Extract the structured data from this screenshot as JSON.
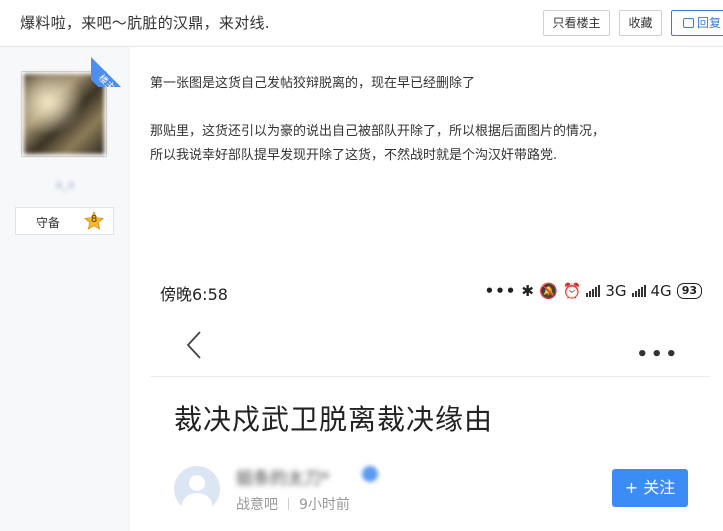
{
  "header": {
    "title": "爆料啦，来吧～肮脏的汉鼎，来对线.",
    "only_louzhu": "只看楼主",
    "favorite": "收藏",
    "reply": "回复"
  },
  "author": {
    "username": "a_a",
    "badge": "楼主",
    "rank_name": "守备",
    "rank_level": "8"
  },
  "post": {
    "lines": [
      "第一张图是这货自己发帖狡辩脱离的，现在早已经删除了",
      "",
      "那贴里，这货还引以为豪的说出自己被部队开除了，所以根据后面图片的情况，",
      "所以我说幸好部队提早发现开除了这货，不然战时就是个沟汉奸带路党."
    ]
  },
  "embedded": {
    "time": "傍晚6:58",
    "network1": "3G",
    "network2": "4G",
    "battery": "93",
    "article_title": "裁决戍武卫脱离裁决缘由",
    "author_name": "姐条的太刀*",
    "forum": "战意吧",
    "time_ago": "9小时前",
    "follow_label": "+ 关注"
  },
  "colors": {
    "accent": "#3b8cf5",
    "badge": "#4d8ff0",
    "sidebar_bg": "#f7f8fa"
  }
}
